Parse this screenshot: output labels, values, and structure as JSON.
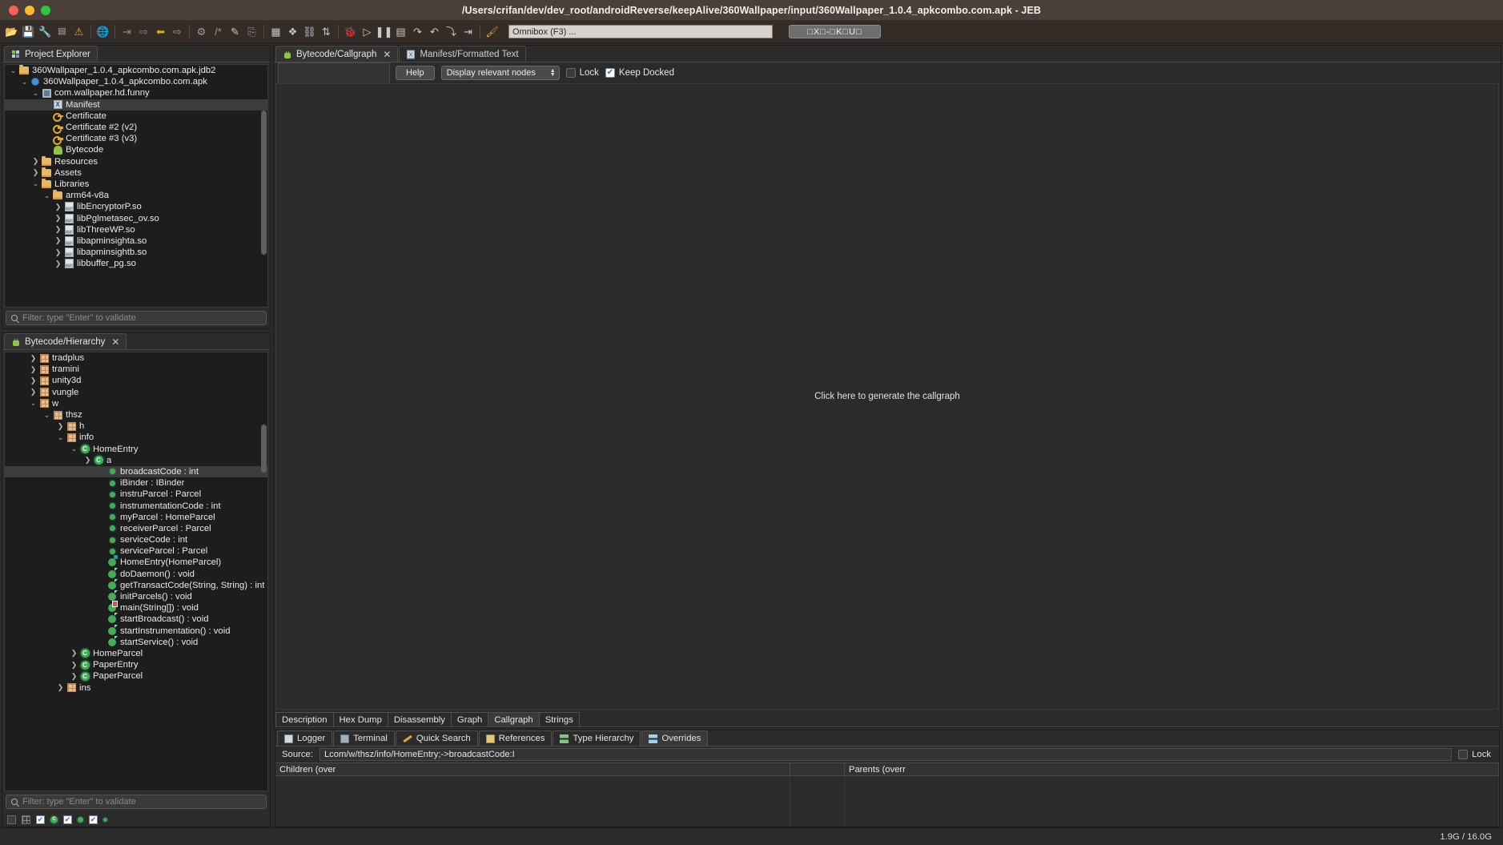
{
  "window": {
    "title": "/Users/crifan/dev/dev_root/androidReverse/keepAlive/360Wallpaper/input/360Wallpaper_1.0.4_apkcombo.com.apk - JEB"
  },
  "toolbar": {
    "icons": [
      "open-folder-icon",
      "save-icon",
      "wrench-icon",
      "terminal-icon",
      "warning-icon",
      "globe-icon",
      "step-into-icon",
      "step-out-icon",
      "back-arrow-icon",
      "forward-arrow-icon",
      "refactor-icon",
      "comment-icon",
      "pencil-icon",
      "goto-icon",
      "grid-icon",
      "graph-icon",
      "hierarchy-icon",
      "sort-icon",
      "debug-icon",
      "run-icon",
      "pause-icon",
      "stop-icon",
      "step-over-icon",
      "step-return-icon",
      "step-branch-icon",
      "resume-icon",
      "highlight-icon"
    ],
    "omnibox_placeholder": "Omnibox (F3) ...",
    "cjk_button_label": "□X□-□K□U□"
  },
  "project_explorer": {
    "tab_label": "Project Explorer",
    "tab_icon": "project-icon",
    "filter_placeholder": "Filter: type \"Enter\" to validate",
    "rows": [
      {
        "label": "360Wallpaper_1.0.4_apkcombo.com.apk.jdb2",
        "indent": 0,
        "twisty": "down",
        "icon": "folder",
        "selected": false
      },
      {
        "label": "360Wallpaper_1.0.4_apkcombo.com.apk",
        "indent": 1,
        "twisty": "down",
        "icon": "circle-blue",
        "selected": false
      },
      {
        "label": "com.wallpaper.hd.funny",
        "indent": 2,
        "twisty": "down",
        "icon": "apk",
        "selected": false
      },
      {
        "label": "Manifest",
        "indent": 3,
        "twisty": "none",
        "icon": "xml",
        "selected": true
      },
      {
        "label": "Certificate",
        "indent": 3,
        "twisty": "none",
        "icon": "key",
        "selected": false
      },
      {
        "label": "Certificate #2 (v2)",
        "indent": 3,
        "twisty": "none",
        "icon": "key",
        "selected": false
      },
      {
        "label": "Certificate #3 (v3)",
        "indent": 3,
        "twisty": "none",
        "icon": "key",
        "selected": false
      },
      {
        "label": "Bytecode",
        "indent": 3,
        "twisty": "none",
        "icon": "droid",
        "selected": false
      },
      {
        "label": "Resources",
        "indent": 2,
        "twisty": "right",
        "icon": "folder",
        "selected": false
      },
      {
        "label": "Assets",
        "indent": 2,
        "twisty": "right",
        "icon": "folder",
        "selected": false
      },
      {
        "label": "Libraries",
        "indent": 2,
        "twisty": "down",
        "icon": "folder",
        "selected": false
      },
      {
        "label": "arm64-v8a",
        "indent": 3,
        "twisty": "down",
        "icon": "folder",
        "selected": false
      },
      {
        "label": "libEncryptorP.so",
        "indent": 4,
        "twisty": "right",
        "icon": "elf",
        "selected": false
      },
      {
        "label": "libPglmetasec_ov.so",
        "indent": 4,
        "twisty": "right",
        "icon": "elf",
        "selected": false
      },
      {
        "label": "libThreeWP.so",
        "indent": 4,
        "twisty": "right",
        "icon": "elf",
        "selected": false
      },
      {
        "label": "libapminsighta.so",
        "indent": 4,
        "twisty": "right",
        "icon": "elf",
        "selected": false
      },
      {
        "label": "libapminsightb.so",
        "indent": 4,
        "twisty": "right",
        "icon": "elf",
        "selected": false
      },
      {
        "label": "libbuffer_pg.so",
        "indent": 4,
        "twisty": "right",
        "icon": "elf",
        "selected": false
      }
    ]
  },
  "hierarchy": {
    "tab_label": "Bytecode/Hierarchy",
    "tab_icon": "android-icon",
    "close_icon": "close-icon",
    "filter_placeholder": "Filter: type \"Enter\" to validate",
    "rows": [
      {
        "label": "tradplus",
        "indent": 1,
        "twisty": "right",
        "icon": "pkg",
        "selected": false
      },
      {
        "label": "tramini",
        "indent": 1,
        "twisty": "right",
        "icon": "pkg",
        "selected": false
      },
      {
        "label": "unity3d",
        "indent": 1,
        "twisty": "right",
        "icon": "pkg",
        "selected": false
      },
      {
        "label": "vungle",
        "indent": 1,
        "twisty": "right",
        "icon": "pkg",
        "selected": false
      },
      {
        "label": "w",
        "indent": 1,
        "twisty": "down",
        "icon": "pkg",
        "selected": false
      },
      {
        "label": "thsz",
        "indent": 2,
        "twisty": "down",
        "icon": "pkg",
        "selected": false
      },
      {
        "label": "h",
        "indent": 3,
        "twisty": "right",
        "icon": "pkg",
        "selected": false
      },
      {
        "label": "info",
        "indent": 3,
        "twisty": "down",
        "icon": "pkg",
        "selected": false
      },
      {
        "label": "HomeEntry",
        "indent": 4,
        "twisty": "down",
        "icon": "class",
        "selected": false
      },
      {
        "label": "a",
        "indent": 5,
        "twisty": "right",
        "icon": "class",
        "selected": false
      },
      {
        "label": "broadcastCode : int",
        "indent": 6,
        "twisty": "none",
        "icon": "field",
        "selected": true
      },
      {
        "label": "iBinder : IBinder",
        "indent": 6,
        "twisty": "none",
        "icon": "field",
        "selected": false
      },
      {
        "label": "instruParcel : Parcel",
        "indent": 6,
        "twisty": "none",
        "icon": "field",
        "selected": false
      },
      {
        "label": "instrumentationCode : int",
        "indent": 6,
        "twisty": "none",
        "icon": "field",
        "selected": false
      },
      {
        "label": "myParcel : HomeParcel",
        "indent": 6,
        "twisty": "none",
        "icon": "field",
        "selected": false
      },
      {
        "label": "receiverParcel : Parcel",
        "indent": 6,
        "twisty": "none",
        "icon": "field",
        "selected": false
      },
      {
        "label": "serviceCode : int",
        "indent": 6,
        "twisty": "none",
        "icon": "field",
        "selected": false
      },
      {
        "label": "serviceParcel : Parcel",
        "indent": 6,
        "twisty": "none",
        "icon": "field",
        "selected": false
      },
      {
        "label": "HomeEntry(HomeParcel)",
        "indent": 6,
        "twisty": "none",
        "icon": "ctor",
        "selected": false
      },
      {
        "label": "doDaemon() : void",
        "indent": 6,
        "twisty": "none",
        "icon": "method",
        "selected": false
      },
      {
        "label": "getTransactCode(String, String) : int",
        "indent": 6,
        "twisty": "none",
        "icon": "method",
        "selected": false
      },
      {
        "label": "initParcels() : void",
        "indent": 6,
        "twisty": "none",
        "icon": "method",
        "selected": false
      },
      {
        "label": "main(String[]) : void",
        "indent": 6,
        "twisty": "none",
        "icon": "main",
        "selected": false
      },
      {
        "label": "startBroadcast() : void",
        "indent": 6,
        "twisty": "none",
        "icon": "method",
        "selected": false
      },
      {
        "label": "startInstrumentation() : void",
        "indent": 6,
        "twisty": "none",
        "icon": "method",
        "selected": false
      },
      {
        "label": "startService() : void",
        "indent": 6,
        "twisty": "none",
        "icon": "method",
        "selected": false
      },
      {
        "label": "HomeParcel",
        "indent": 4,
        "twisty": "right",
        "icon": "class",
        "selected": false
      },
      {
        "label": "PaperEntry",
        "indent": 4,
        "twisty": "right",
        "icon": "class",
        "selected": false
      },
      {
        "label": "PaperParcel",
        "indent": 4,
        "twisty": "right",
        "icon": "class",
        "selected": false
      },
      {
        "label": "ins",
        "indent": 3,
        "twisty": "right",
        "icon": "pkg",
        "selected": false
      }
    ],
    "status_icons": [
      "panel-icon",
      "grid-icon",
      "checkbox-class",
      "class-dot",
      "checkbox-method",
      "method-dot",
      "checkbox-field",
      "field-dot"
    ]
  },
  "editor": {
    "tabs": [
      {
        "label": "Bytecode/Callgraph",
        "icon": "android-icon",
        "active": true,
        "closable": true
      },
      {
        "label": "Manifest/Formatted Text",
        "icon": "xml-icon",
        "active": false,
        "closable": false
      }
    ]
  },
  "callgraph": {
    "help_label": "Help",
    "select_value": "Display relevant nodes",
    "lock_label": "Lock",
    "lock_checked": false,
    "keep_docked_label": "Keep Docked",
    "keep_docked_checked": true,
    "hint": "Click here to generate the callgraph"
  },
  "doc_tabs": [
    {
      "label": "Description",
      "active": false
    },
    {
      "label": "Hex Dump",
      "active": false
    },
    {
      "label": "Disassembly",
      "active": false
    },
    {
      "label": "Graph",
      "active": false
    },
    {
      "label": "Callgraph",
      "active": true
    },
    {
      "label": "Strings",
      "active": false
    }
  ],
  "dock": {
    "tabs": [
      {
        "label": "Logger",
        "icon": "logger",
        "active": false
      },
      {
        "label": "Terminal",
        "icon": "terminal",
        "active": false
      },
      {
        "label": "Quick Search",
        "icon": "search",
        "active": false
      },
      {
        "label": "References",
        "icon": "refs",
        "active": false
      },
      {
        "label": "Type Hierarchy",
        "icon": "typeh",
        "active": false
      },
      {
        "label": "Overrides",
        "icon": "over",
        "active": true
      }
    ],
    "source_label": "Source:",
    "source_value": "Lcom/w/thsz/info/HomeEntry;->broadcastCode:I",
    "lock_label": "Lock",
    "lock_checked": false,
    "columns": [
      "Children (over",
      "",
      "Parents (overr"
    ]
  },
  "statusbar": {
    "memory": "1.9G / 16.0G"
  },
  "colors": {
    "accent": "#4a8fd6",
    "titlebar": "#4a3f38",
    "toolbar": "#332c27",
    "panel": "#2b2b2b",
    "tree_bg": "#1d1d1d",
    "selection": "#3c3c3c",
    "text": "#e8e8e8",
    "green": "#3fae54",
    "gold": "#e0a92b"
  }
}
